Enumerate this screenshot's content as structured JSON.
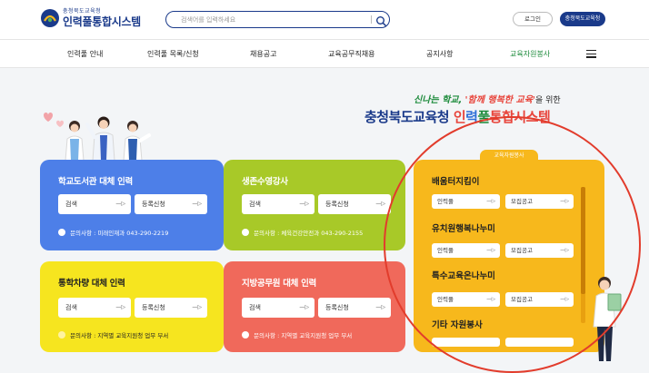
{
  "header": {
    "logo_sub": "충청북도교육청",
    "logo_title": "인력풀통합시스템",
    "search_placeholder": "검색어를 입력하세요",
    "login_label": "로그인",
    "office_label": "충청북도교육청"
  },
  "nav": {
    "items": [
      {
        "label": "인력풀 안내"
      },
      {
        "label": "인력풀 목록/신청"
      },
      {
        "label": "채용공고"
      },
      {
        "label": "교육공무직채용"
      },
      {
        "label": "공지사항"
      },
      {
        "label": "교육자원봉사"
      }
    ]
  },
  "hero": {
    "tagline_pre": "신나는 학교,",
    "tagline_quote": "'함께 행복한 교육'",
    "tagline_suffix": "을 위한",
    "title_prefix": "충청북도교육청",
    "title_w1": "인",
    "title_w2": "력",
    "title_w3": "풀",
    "title_w4": "통합시스템"
  },
  "cards": [
    {
      "title": "학교도서관 대체 인력",
      "search": "검색",
      "register": "등록신청",
      "contact": "문의사항 : 미래인재과 043-290-2219"
    },
    {
      "title": "생존수영강사",
      "search": "검색",
      "register": "등록신청",
      "contact": "문의사항 : 체육건강안전과 043-290-2155"
    },
    {
      "title": "통학차량 대체 인력",
      "search": "검색",
      "register": "등록신청",
      "contact": "문의사항 : 지역별 교육지원청 업무 부서"
    },
    {
      "title": "지방공무원 대체 인력",
      "search": "검색",
      "register": "등록신청",
      "contact": "문의사항 : 지역별 교육지원청 업무 부서"
    }
  ],
  "volunteer": {
    "badge": "교육자원봉사",
    "sections": [
      {
        "title": "배움터지킴이",
        "btn1": "인력풀",
        "btn2": "모집공고"
      },
      {
        "title": "유치원행복나누미",
        "btn1": "인력풀",
        "btn2": "모집공고"
      },
      {
        "title": "특수교육온나누미",
        "btn1": "인력풀",
        "btn2": "모집공고"
      },
      {
        "title": "기타 자원봉사",
        "btn1": "",
        "btn2": ""
      }
    ]
  },
  "colors": {
    "brand": "#1a3a8a",
    "card_blue": "#4d7fe8",
    "card_green": "#a8c928",
    "card_yellow": "#f6e51f",
    "card_red": "#f0695b",
    "volunteer_orange": "#f7b81c",
    "highlight_circle": "#e23c2c"
  }
}
